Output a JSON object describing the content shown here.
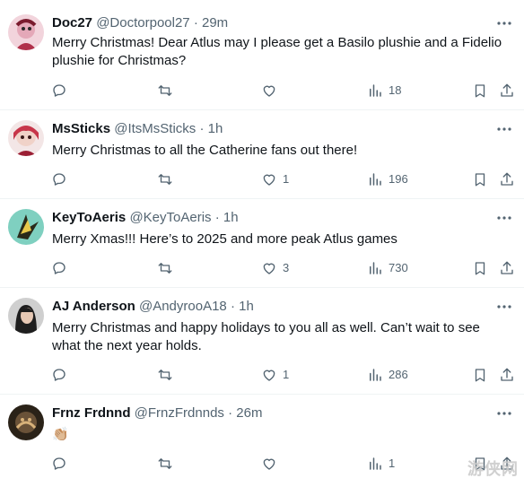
{
  "posts": [
    {
      "name": "Doc27",
      "handle": "@Doctorpool27",
      "time": "29m",
      "text": "Merry Christmas! Dear Atlus may I please get a Basilo plushie and a Fidelio plushie for Christmas?",
      "replies": "",
      "reposts": "",
      "likes": "",
      "views": "18",
      "avatar_color": "#e4a8b8"
    },
    {
      "name": "MsSticks",
      "handle": "@ItsMsSticks",
      "time": "1h",
      "text": "Merry Christmas to all the Catherine fans out there!",
      "replies": "",
      "reposts": "",
      "likes": "1",
      "views": "196",
      "avatar_color": "#c7364a"
    },
    {
      "name": "KeyToAeris",
      "handle": "@KeyToAeris",
      "time": "1h",
      "text": "Merry Xmas!!! Here’s to 2025 and more peak Atlus games",
      "replies": "",
      "reposts": "",
      "likes": "3",
      "views": "730",
      "avatar_color": "#5bb8a6"
    },
    {
      "name": "AJ Anderson",
      "handle": "@AndyrooA18",
      "time": "1h",
      "text": "Merry Christmas and happy holidays to you all as well. Can’t wait to see what the next year holds.",
      "replies": "",
      "reposts": "",
      "likes": "1",
      "views": "286",
      "avatar_color": "#3a3a3a"
    },
    {
      "name": "Frnz Frdnnd",
      "handle": "@FrnzFrdnnds",
      "time": "26m",
      "text": "👏🏼",
      "replies": "",
      "reposts": "",
      "likes": "",
      "views": "1",
      "avatar_color": "#4a3a2a"
    }
  ],
  "watermark": "游侠网",
  "icons": {
    "reply": "reply-icon",
    "repost": "repost-icon",
    "like": "like-icon",
    "views": "views-icon",
    "bookmark": "bookmark-icon",
    "share": "share-icon",
    "more": "more-icon"
  },
  "colors": {
    "text": "#0f1419",
    "secondary": "#536471",
    "divider": "#eff3f4"
  }
}
